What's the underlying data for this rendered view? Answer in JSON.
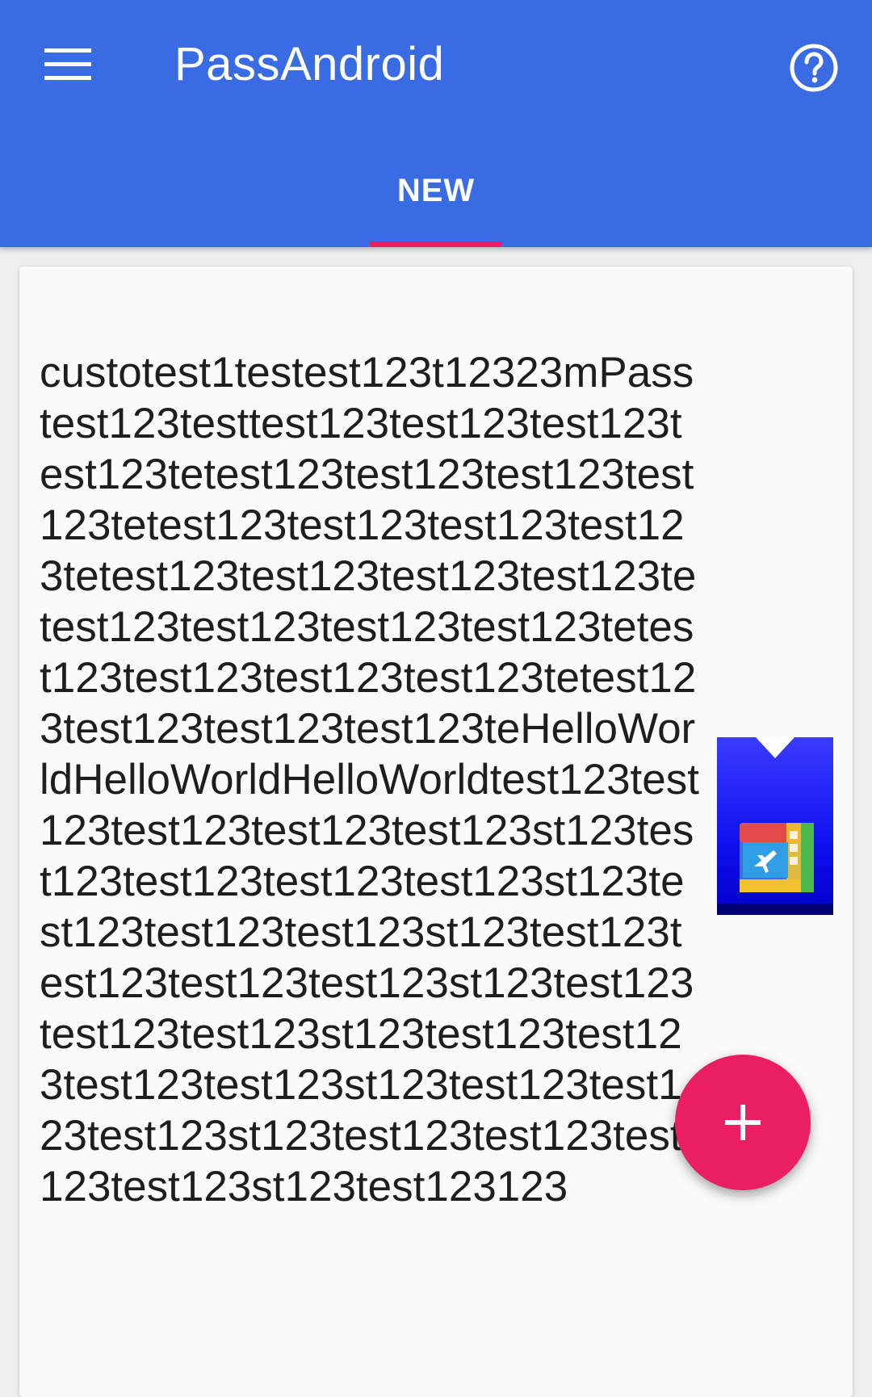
{
  "app": {
    "title": "PassAndroid",
    "bar_color": "#396be2",
    "accent_color": "#e91e63"
  },
  "toolbar": {
    "menu_icon": "hamburger-menu-icon",
    "help_icon": "help-circle-icon"
  },
  "tabs": [
    {
      "label": "NEW",
      "selected": true
    }
  ],
  "pass": {
    "description": "custotest1testest123t12323mPasstest123testtest123test123test123test123tetest123test123test123test123tetest123test123test123test123tetest123test123test123test123tetest123test123test123test123tetest123test123test123test123tetest123test123test123test123teHelloWorldHelloWorldHelloWorldtest123test123test123test123test123st123test123test123test123test123st123test123test123test123st123test123test123test123test123st123test123test123test123st123test123test123test123test123st123test123test123test123st123test123test123test123test123st123test123123",
    "thumbnail_icon": "boarding-pass-plane-icon"
  },
  "fab": {
    "icon": "plus-icon"
  }
}
